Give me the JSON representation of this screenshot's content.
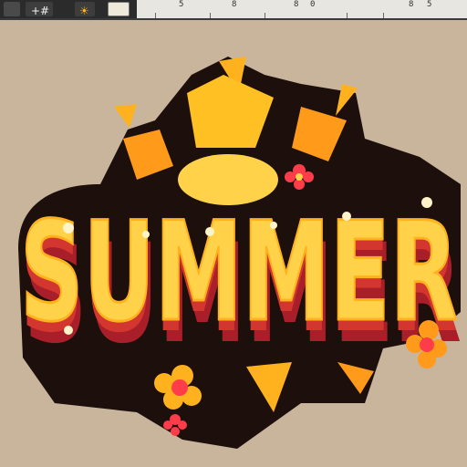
{
  "toolbar": {
    "tools": [
      {
        "icon": "layer-icon"
      },
      {
        "icon": "grid-plus-icon",
        "glyph": "+#"
      },
      {
        "icon": "sun-tool-icon",
        "glyph": "☀"
      },
      {
        "icon": "rectangle-tool-icon"
      }
    ],
    "ruler_ticks": [
      "5",
      "8",
      "8",
      "0",
      "8",
      "5"
    ]
  },
  "artwork": {
    "word": "SUMMER",
    "colors": {
      "background": "#c8b59b",
      "outline": "#1c0f0c",
      "letter_fill": "#ffd24a",
      "letter_shadow": "#d2362e",
      "letter_depth": "#a81f2a",
      "sun": "#ffb21e",
      "flower": "#ff3d4a"
    }
  }
}
